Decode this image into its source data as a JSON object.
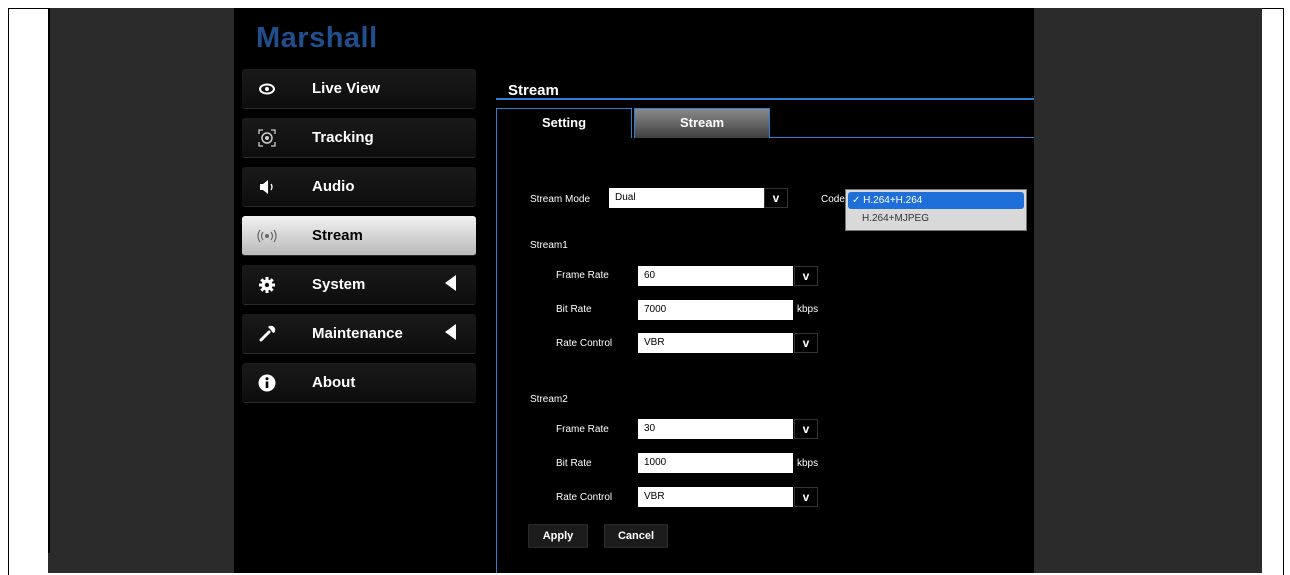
{
  "app": {
    "logo": "Marshall"
  },
  "sidebar": {
    "items": [
      {
        "label": "Live View",
        "icon": "eye-icon",
        "active": false,
        "expandable": false
      },
      {
        "label": "Tracking",
        "icon": "tracking-icon",
        "active": false,
        "expandable": false
      },
      {
        "label": "Audio",
        "icon": "speaker-icon",
        "active": false,
        "expandable": false
      },
      {
        "label": "Stream",
        "icon": "stream-icon",
        "active": true,
        "expandable": false
      },
      {
        "label": "System",
        "icon": "gear-icon",
        "active": false,
        "expandable": true
      },
      {
        "label": "Maintenance",
        "icon": "wrench-icon",
        "active": false,
        "expandable": true
      },
      {
        "label": "About",
        "icon": "info-icon",
        "active": false,
        "expandable": false
      }
    ]
  },
  "main": {
    "title": "Stream",
    "tabs": [
      {
        "label": "Setting",
        "active": false
      },
      {
        "label": "Stream",
        "active": true
      }
    ],
    "stream_mode": {
      "label": "Stream Mode",
      "value": "Dual"
    },
    "codec": {
      "label": "Codec",
      "options": [
        {
          "label": "✓ H.264+H.264",
          "selected": true
        },
        {
          "label": "H.264+MJPEG",
          "selected": false
        }
      ]
    },
    "stream1": {
      "heading": "Stream1",
      "frame_rate": {
        "label": "Frame Rate",
        "value": "60"
      },
      "bit_rate": {
        "label": "Bit Rate",
        "value": "7000",
        "unit": "kbps"
      },
      "rate_control": {
        "label": "Rate Control",
        "value": "VBR"
      }
    },
    "stream2": {
      "heading": "Stream2",
      "frame_rate": {
        "label": "Frame Rate",
        "value": "30"
      },
      "bit_rate": {
        "label": "Bit Rate",
        "value": "1000",
        "unit": "kbps"
      },
      "rate_control": {
        "label": "Rate Control",
        "value": "VBR"
      }
    },
    "buttons": {
      "apply": "Apply",
      "cancel": "Cancel"
    },
    "select_arrow": "v"
  },
  "colors": {
    "accent": "#2d7fd0",
    "logo": "#1f4f8c",
    "selection": "#1e6fd9",
    "background": "#000000",
    "side_panel": "#2b2b2b"
  }
}
